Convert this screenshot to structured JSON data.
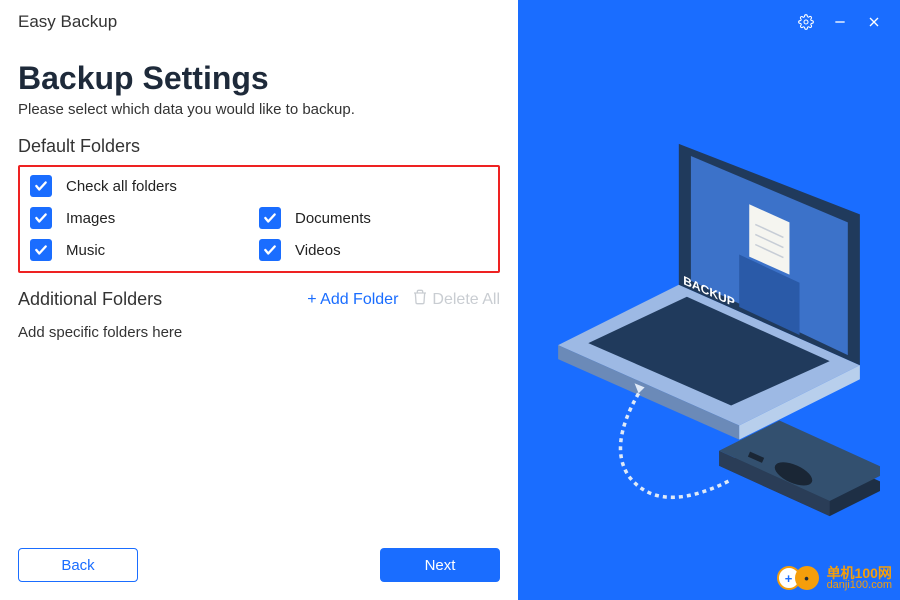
{
  "app_title": "Easy Backup",
  "header": {
    "title": "Backup Settings",
    "description": "Please select which data you would like to backup."
  },
  "default_folders": {
    "label": "Default Folders",
    "check_all": {
      "label": "Check all folders",
      "checked": true
    },
    "items": [
      {
        "label": "Images",
        "checked": true
      },
      {
        "label": "Documents",
        "checked": true
      },
      {
        "label": "Music",
        "checked": true
      },
      {
        "label": "Videos",
        "checked": true
      }
    ]
  },
  "additional": {
    "label": "Additional Folders",
    "add_label": "+ Add Folder",
    "delete_label": "Delete All",
    "placeholder": "Add specific folders here"
  },
  "buttons": {
    "back": "Back",
    "next": "Next"
  },
  "illustration": {
    "screen_text": "BACKUP"
  },
  "watermark": {
    "cn": "单机100网",
    "url": "danji100.com"
  },
  "colors": {
    "accent": "#1a6dff",
    "highlight": "#e22",
    "watermark": "#f59e0b"
  }
}
